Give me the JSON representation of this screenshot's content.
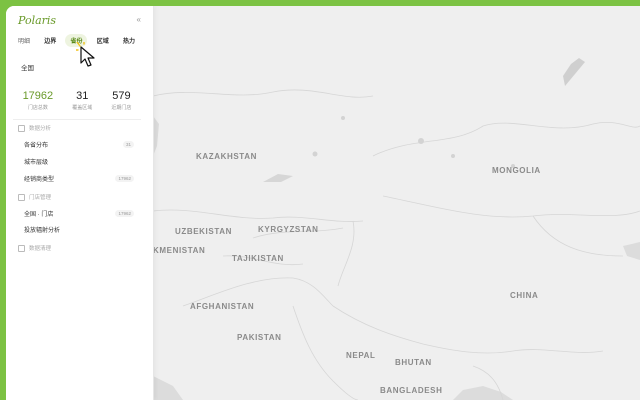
{
  "app": {
    "brand": "Polaris",
    "collapse_icon": "«"
  },
  "tabs": [
    {
      "label": "明细",
      "active": false
    },
    {
      "label": "边界",
      "active": false
    },
    {
      "label": "省份",
      "active": true
    },
    {
      "label": "区域",
      "active": false
    },
    {
      "label": "热力",
      "active": false
    }
  ],
  "scope": "全国",
  "stats": [
    {
      "value": "17962",
      "label": "门店总数"
    },
    {
      "value": "31",
      "label": "覆盖区域"
    },
    {
      "value": "579",
      "label": "近期门店"
    }
  ],
  "sections": {
    "data_analysis": {
      "title": "数据分析",
      "items": [
        {
          "label": "各省分布",
          "badge": "31"
        },
        {
          "label": "城市层级",
          "badge": ""
        },
        {
          "label": "经销商类型",
          "badge": "17962"
        }
      ]
    },
    "store_management": {
      "title": "门店管理",
      "items": [
        {
          "label": "全国 · 门店",
          "badge": "17962"
        },
        {
          "label": "投放辐射分析",
          "badge": ""
        }
      ]
    },
    "data_cleanup": {
      "title": "数据清理"
    }
  },
  "map": {
    "countries": [
      "KAZAKHSTAN",
      "MONGOLIA",
      "UZBEKISTAN",
      "KYRGYZSTAN",
      "KMENISTAN",
      "TAJIKISTAN",
      "AFGHANISTAN",
      "CHINA",
      "PAKISTAN",
      "NEPAL",
      "BHUTAN",
      "BANGLADESH"
    ]
  },
  "colors": {
    "accent": "#6a9a2a",
    "frame": "#7cc243",
    "map_bg": "#efefef"
  }
}
